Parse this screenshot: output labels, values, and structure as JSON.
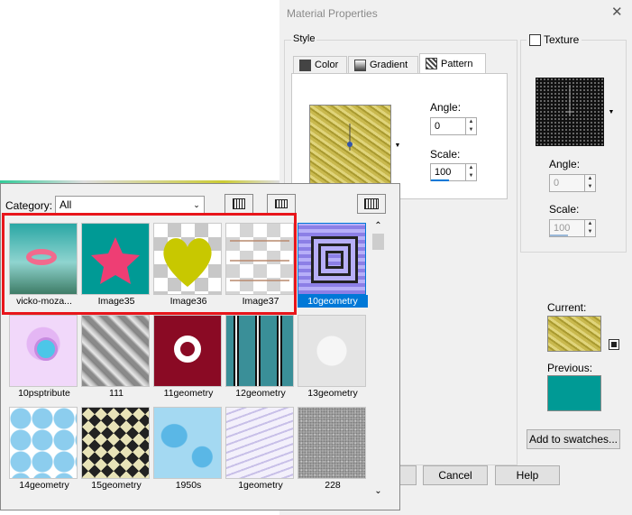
{
  "window": {
    "title": "Material Properties",
    "close": "✕"
  },
  "style": {
    "label": "Style",
    "tabs": [
      {
        "label": "Color",
        "icon": "color-tab-icon"
      },
      {
        "label": "Gradient",
        "icon": "gradient-tab-icon"
      },
      {
        "label": "Pattern",
        "icon": "pattern-tab-icon"
      }
    ],
    "angle_label": "Angle:",
    "angle_value": "0",
    "scale_label": "Scale:",
    "scale_value": "100"
  },
  "texture": {
    "label": "Texture",
    "checked": false,
    "angle_label": "Angle:",
    "angle_value": "0",
    "scale_label": "Scale:",
    "scale_value": "100"
  },
  "current_label": "Current:",
  "previous_label": "Previous:",
  "add_to_swatches": "Add to swatches...",
  "buttons": {
    "cancel": "Cancel",
    "help": "Help"
  },
  "picker": {
    "category_label": "Category:",
    "category_value": "All",
    "selected": "10geometry",
    "items": [
      {
        "label": "vicko-moza..."
      },
      {
        "label": "Image35"
      },
      {
        "label": "Image36"
      },
      {
        "label": "Image37"
      },
      {
        "label": "10geometry"
      },
      {
        "label": "10psptribute"
      },
      {
        "label": "111"
      },
      {
        "label": "11geometry"
      },
      {
        "label": "12geometry"
      },
      {
        "label": "13geometry"
      },
      {
        "label": "14geometry"
      },
      {
        "label": "15geometry"
      },
      {
        "label": "1950s"
      },
      {
        "label": "1geometry"
      },
      {
        "label": "228"
      }
    ]
  },
  "colors": {
    "accent": "#0078d7",
    "highlight": "#e8151b",
    "teal": "#009a95"
  }
}
